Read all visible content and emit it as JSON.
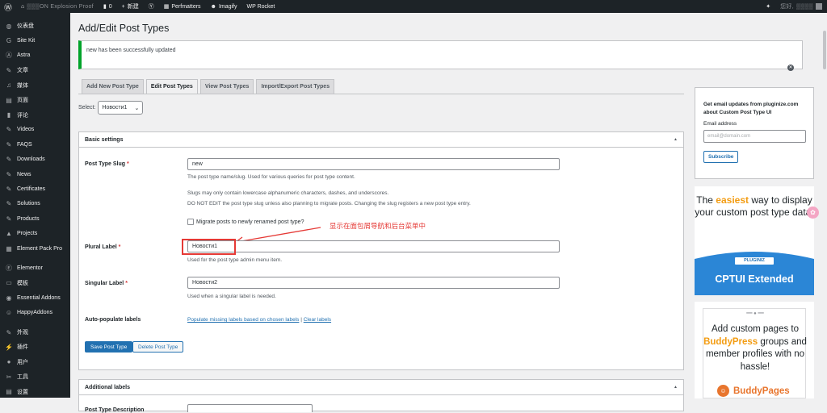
{
  "adminbar": {
    "site_name": "▒▒▒ON Explosion Proof",
    "comments_count": "0",
    "new_label": "新建",
    "perfmatters": "Perfmatters",
    "imagify": "Imagify",
    "wp_rocket": "WP Rocket",
    "greeting": "您好,",
    "user": "▒▒▒▒"
  },
  "menu": {
    "items": [
      {
        "icon": "dashboard-icon",
        "glyph": "◍",
        "label": "仪表盘"
      },
      {
        "icon": "sitekit-icon",
        "glyph": "G",
        "label": "Site Kit"
      },
      {
        "icon": "astra-icon",
        "glyph": "Ⓐ",
        "label": "Astra"
      },
      {
        "icon": "pin-icon",
        "glyph": "✎",
        "label": "文章"
      },
      {
        "icon": "media-icon",
        "glyph": "♫",
        "label": "媒体"
      },
      {
        "icon": "page-icon",
        "glyph": "▤",
        "label": "页面"
      },
      {
        "icon": "comment-icon",
        "glyph": "▮",
        "label": "评论"
      },
      {
        "icon": "pin-icon",
        "glyph": "✎",
        "label": "Videos"
      },
      {
        "icon": "pin-icon",
        "glyph": "✎",
        "label": "FAQS"
      },
      {
        "icon": "pin-icon",
        "glyph": "✎",
        "label": "Downloads"
      },
      {
        "icon": "pin-icon",
        "glyph": "✎",
        "label": "News"
      },
      {
        "icon": "pin-icon",
        "glyph": "✎",
        "label": "Certificates"
      },
      {
        "icon": "pin-icon",
        "glyph": "✎",
        "label": "Solutions"
      },
      {
        "icon": "pin-icon",
        "glyph": "✎",
        "label": "Products"
      },
      {
        "icon": "projects-icon",
        "glyph": "▲",
        "label": "Projects"
      },
      {
        "icon": "element-pack-icon",
        "glyph": "▦",
        "label": "Element Pack Pro"
      }
    ],
    "items2": [
      {
        "icon": "elementor-icon",
        "glyph": "Ⓔ",
        "label": "Elementor"
      },
      {
        "icon": "template-icon",
        "glyph": "▭",
        "label": "模板"
      },
      {
        "icon": "essential-addons-icon",
        "glyph": "◉",
        "label": "Essential Addons"
      },
      {
        "icon": "happyaddons-icon",
        "glyph": "☺",
        "label": "HappyAddons"
      }
    ],
    "items3": [
      {
        "icon": "appearance-icon",
        "glyph": "✎",
        "label": "外观"
      },
      {
        "icon": "plugin-icon",
        "glyph": "⚡",
        "label": "插件"
      },
      {
        "icon": "user-icon",
        "glyph": "●",
        "label": "用户"
      },
      {
        "icon": "tools-icon",
        "glyph": "✂",
        "label": "工具"
      },
      {
        "icon": "settings-icon",
        "glyph": "▤",
        "label": "设置"
      }
    ]
  },
  "page": {
    "title": "Add/Edit Post Types",
    "notice": "new has been successfully updated",
    "tabs": [
      "Add New Post Type",
      "Edit Post Types",
      "View Post Types",
      "Import/Export Post Types"
    ],
    "select_label": "Select:",
    "select_value": "Новости1"
  },
  "basic": {
    "title": "Basic settings",
    "slug_label": "Post Type Slug",
    "req": "*",
    "slug_value": "new",
    "slug_desc": "The post type name/slug. Used for various queries for post type content.",
    "slug_note1": "Slugs may only contain lowercase alphanumeric characters, dashes, and underscores.",
    "slug_note2": "DO NOT EDIT the post type slug unless also planning to migrate posts. Changing the slug registers a new post type entry.",
    "migrate_label": "Migrate posts to newly renamed post type?",
    "annotation": "显示在面包屑导航和后台菜单中",
    "plural_label": "Plural Label",
    "plural_value": "Новости1",
    "plural_desc": "Used for the post type admin menu item.",
    "singular_label": "Singular Label",
    "singular_value": "Новости2",
    "singular_desc": "Used when a singular label is needed.",
    "auto_label": "Auto-populate labels",
    "populate_link": "Populate missing labels based on chosen labels",
    "sep": " | ",
    "clear_link": "Clear labels",
    "save_btn": "Save Post Type",
    "delete_btn": "Delete Post Type"
  },
  "additional": {
    "title": "Additional labels",
    "desc_label": "Post Type Description"
  },
  "sidebar": {
    "newsletter_title": "Get email updates from pluginize.com about Custom Post Type UI",
    "email_label": "Email address",
    "email_placeholder": "email@domain.com",
    "subscribe": "Subscribe",
    "ad1_pre": "The ",
    "ad1_hl": "easiest",
    "ad1_post": " way to display your custom post type data!",
    "ad1_badge": "PLUGINIZ",
    "ad1_ext": "CPTUI Extended",
    "ad2_pre": "Add custom pages to ",
    "ad2_hl": "BuddyPress",
    "ad2_post": " groups and member profiles with no hassle!",
    "ad2_logo": "BuddyPages"
  },
  "colors": {
    "accent": "#2271b1",
    "success": "#00a32a",
    "annotation": "#e53935",
    "ad_blue": "#2b86d6",
    "ad_orange": "#f39c12"
  }
}
